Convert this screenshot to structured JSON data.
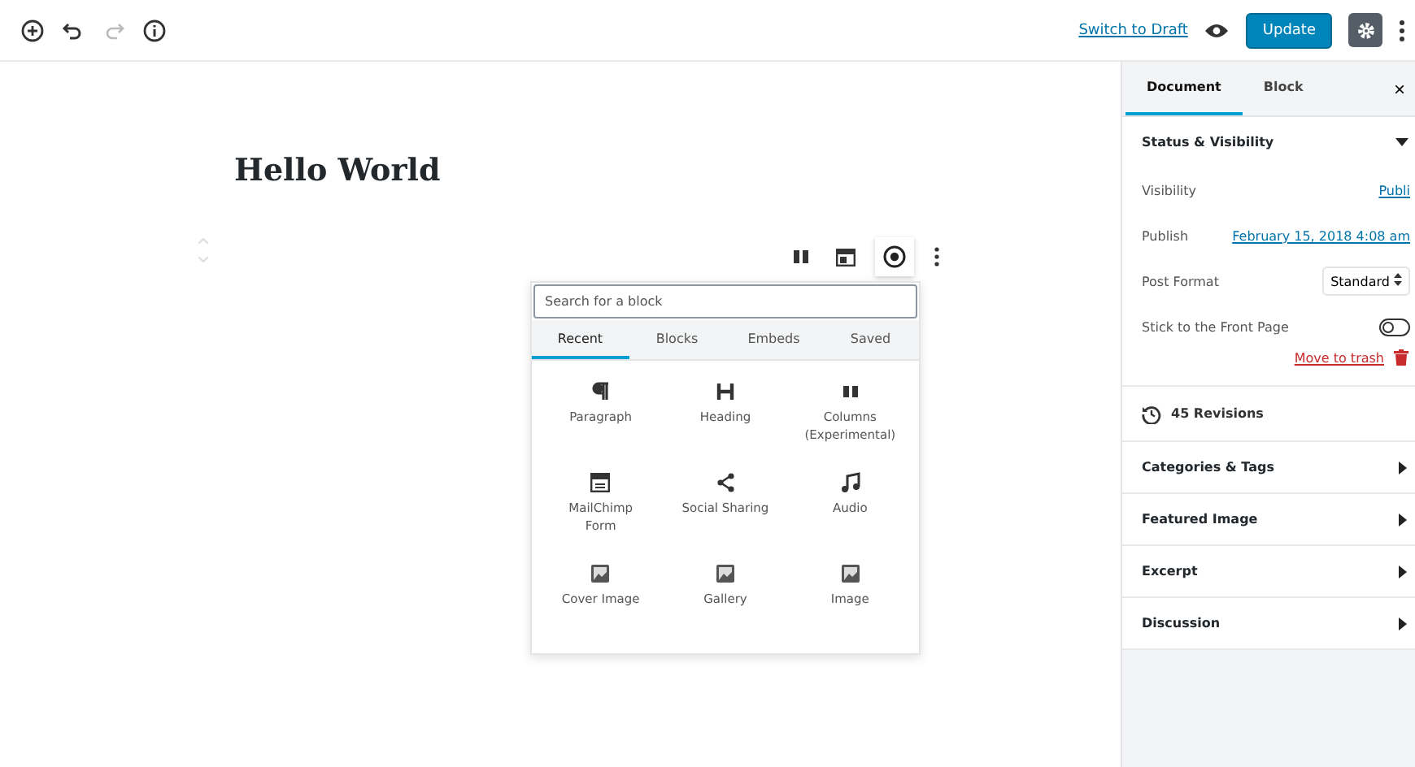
{
  "top_bar": {
    "switch_link": "Switch to Draft",
    "update_button": "Update",
    "settings_active": true
  },
  "editor": {
    "title": "Hello World"
  },
  "inserter": {
    "search": {
      "placeholder": "Search for a block"
    },
    "tabs": [
      {
        "label": "Recent",
        "selected": true
      },
      {
        "label": "Blocks",
        "selected": false
      },
      {
        "label": "Embeds",
        "selected": false
      },
      {
        "label": "Saved",
        "selected": false
      }
    ],
    "blocks": [
      {
        "label": "Paragraph"
      },
      {
        "label": "Heading"
      },
      {
        "label": "Columns (Experimental)"
      },
      {
        "label": "MailChimp Form"
      },
      {
        "label": "Social Sharing"
      },
      {
        "label": "Audio"
      },
      {
        "label": "Cover Image"
      },
      {
        "label": "Gallery"
      },
      {
        "label": "Image"
      }
    ]
  },
  "sidebar": {
    "tabs": [
      {
        "label": "Document",
        "selected": true
      },
      {
        "label": "Block",
        "selected": false
      }
    ],
    "close": "×",
    "status": {
      "title": "Status & Visibility",
      "expanded": true,
      "rows": [
        {
          "label": "Visibility",
          "value": "Publi",
          "kind": "link"
        },
        {
          "label": "Publish",
          "value": "February 15, 2018 4:08 am",
          "kind": "link"
        },
        {
          "label": "Post Format",
          "value": "Standard",
          "kind": "select"
        },
        {
          "label": "Stick to the Front Page",
          "kind": "toggle",
          "on": false
        }
      ],
      "trash": "Move to trash"
    },
    "revisions": "45 Revisions",
    "panels": [
      {
        "title": "Categories & Tags",
        "expanded": false
      },
      {
        "title": "Featured Image",
        "expanded": false
      },
      {
        "title": "Excerpt",
        "expanded": false
      },
      {
        "title": "Discussion",
        "expanded": false
      }
    ]
  }
}
